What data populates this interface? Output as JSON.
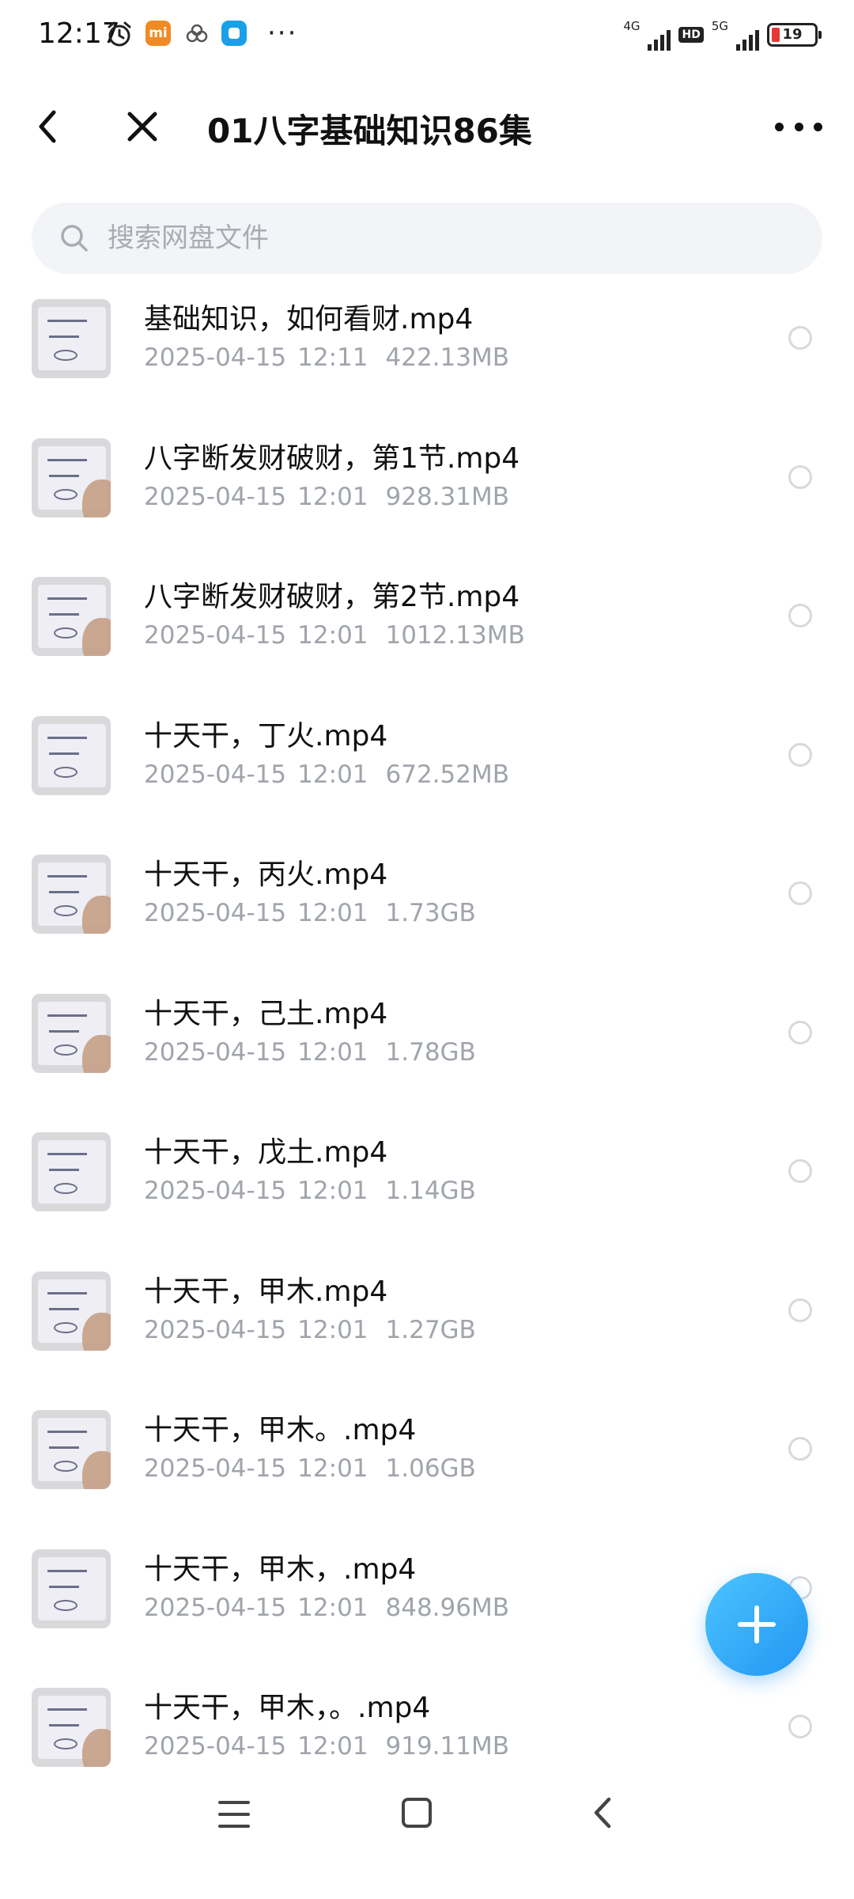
{
  "status_bar": {
    "time": "12:17",
    "app_badge": "mi",
    "more": "···",
    "net1": "4G",
    "hd": "HD",
    "net2": "5G",
    "battery": "19"
  },
  "header": {
    "title": "01八字基础知识86集"
  },
  "search": {
    "placeholder": "搜索网盘文件"
  },
  "files": [
    {
      "name": "基础知识，如何看财.mp4",
      "date": "2025-04-15",
      "time": "12:11",
      "size": "422.13MB"
    },
    {
      "name": "八字断发财破财，第1节.mp4",
      "date": "2025-04-15",
      "time": "12:01",
      "size": "928.31MB"
    },
    {
      "name": "八字断发财破财，第2节.mp4",
      "date": "2025-04-15",
      "time": "12:01",
      "size": "1012.13MB"
    },
    {
      "name": "十天干，丁火.mp4",
      "date": "2025-04-15",
      "time": "12:01",
      "size": "672.52MB"
    },
    {
      "name": "十天干，丙火.mp4",
      "date": "2025-04-15",
      "time": "12:01",
      "size": "1.73GB"
    },
    {
      "name": "十天干，己土.mp4",
      "date": "2025-04-15",
      "time": "12:01",
      "size": "1.78GB"
    },
    {
      "name": "十天干，戊土.mp4",
      "date": "2025-04-15",
      "time": "12:01",
      "size": "1.14GB"
    },
    {
      "name": "十天干，甲木.mp4",
      "date": "2025-04-15",
      "time": "12:01",
      "size": "1.27GB"
    },
    {
      "name": "十天干，甲木。.mp4",
      "date": "2025-04-15",
      "time": "12:01",
      "size": "1.06GB"
    },
    {
      "name": "十天干，甲木，.mp4",
      "date": "2025-04-15",
      "time": "12:01",
      "size": "848.96MB"
    },
    {
      "name": "十天干，甲木，。.mp4",
      "date": "2025-04-15",
      "time": "12:01",
      "size": "919.11MB"
    }
  ],
  "icons": {
    "back": "chevron-left-icon",
    "close": "close-icon",
    "more": "more-horizontal-icon",
    "search": "search-icon",
    "fab": "plus-icon",
    "nav_menu": "menu-icon",
    "nav_home": "home-square-icon",
    "nav_back": "nav-back-icon"
  },
  "colors": {
    "accent": "#2196f3",
    "meta_text": "#a0a4ab",
    "search_bg": "#f3f4f7"
  }
}
